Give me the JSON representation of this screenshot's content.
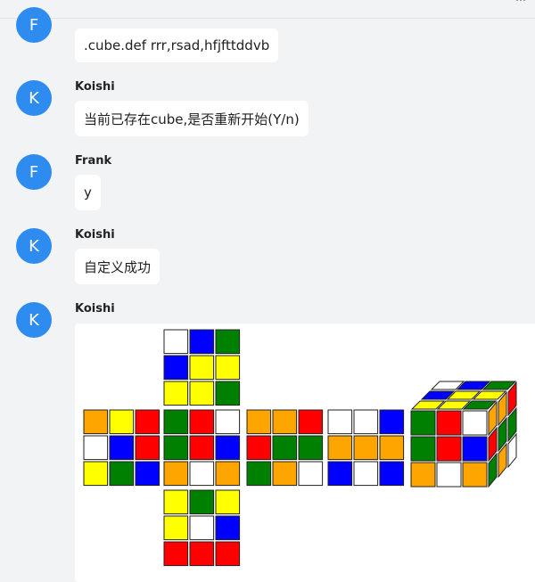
{
  "header": {
    "fragment": "…"
  },
  "messages": [
    {
      "avatar_letter": "F",
      "author": "",
      "text": ".cube.def rrr,rsad,hfjfttddvb"
    },
    {
      "avatar_letter": "K",
      "author": "Koishi",
      "text": "当前已存在cube,是否重新开始(Y/n)"
    },
    {
      "avatar_letter": "F",
      "author": "Frank",
      "text": "y"
    },
    {
      "avatar_letter": "K",
      "author": "Koishi",
      "text": "自定义成功"
    },
    {
      "avatar_letter": "K",
      "author": "Koishi",
      "text": ""
    }
  ],
  "colors": {
    "avatar": "#2e8bf0",
    "W": "#ffffff",
    "Y": "#ffff00",
    "G": "#008000",
    "B": "#0000ff",
    "R": "#ff0000",
    "O": "#ffa500"
  },
  "cube_image": {
    "faces": {
      "up": [
        "W",
        "B",
        "G",
        "B",
        "Y",
        "Y",
        "Y",
        "Y",
        "G"
      ],
      "left": [
        "O",
        "Y",
        "R",
        "W",
        "B",
        "R",
        "Y",
        "G",
        "B"
      ],
      "front": [
        "G",
        "R",
        "W",
        "G",
        "R",
        "B",
        "O",
        "W",
        "O"
      ],
      "right": [
        "O",
        "O",
        "R",
        "R",
        "G",
        "G",
        "G",
        "O",
        "W"
      ],
      "back": [
        "W",
        "W",
        "B",
        "O",
        "O",
        "O",
        "B",
        "W",
        "B"
      ],
      "down": [
        "Y",
        "G",
        "Y",
        "Y",
        "W",
        "B",
        "R",
        "R",
        "R"
      ]
    },
    "iso": {
      "top": [
        "W",
        "B",
        "G",
        "B",
        "Y",
        "Y",
        "Y",
        "Y",
        "G"
      ],
      "front": [
        "G",
        "R",
        "W",
        "G",
        "R",
        "B",
        "O",
        "W",
        "O"
      ],
      "side": [
        "O",
        "O",
        "R",
        "R",
        "G",
        "G",
        "G",
        "O",
        "W"
      ]
    }
  }
}
